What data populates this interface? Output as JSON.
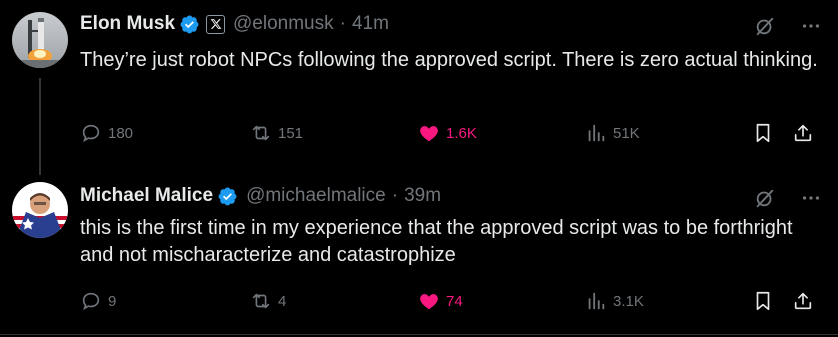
{
  "tweets": [
    {
      "name": "Elon Musk",
      "handle": "@elonmusk",
      "separator": "·",
      "time": "41m",
      "text": "They’re just robot NPCs following the approved script. There is zero actual thinking.",
      "replies": "180",
      "retweets": "151",
      "likes": "1.6K",
      "views": "51K",
      "affiliation_badge": "x-logo-icon"
    },
    {
      "name": "Michael Malice",
      "handle": "@michaelmalice",
      "separator": "·",
      "time": "39m",
      "text": "this is the first time in my experience that the approved script was to be forthright and not mischaracterize and catastrophize",
      "replies": "9",
      "retweets": "4",
      "likes": "74",
      "views": "3.1K"
    }
  ],
  "colors": {
    "background": "#000000",
    "text": "#e7e9ea",
    "secondary": "#71767b",
    "verified": "#1d9bf0",
    "like": "#f91880",
    "divider": "#2f3336"
  }
}
